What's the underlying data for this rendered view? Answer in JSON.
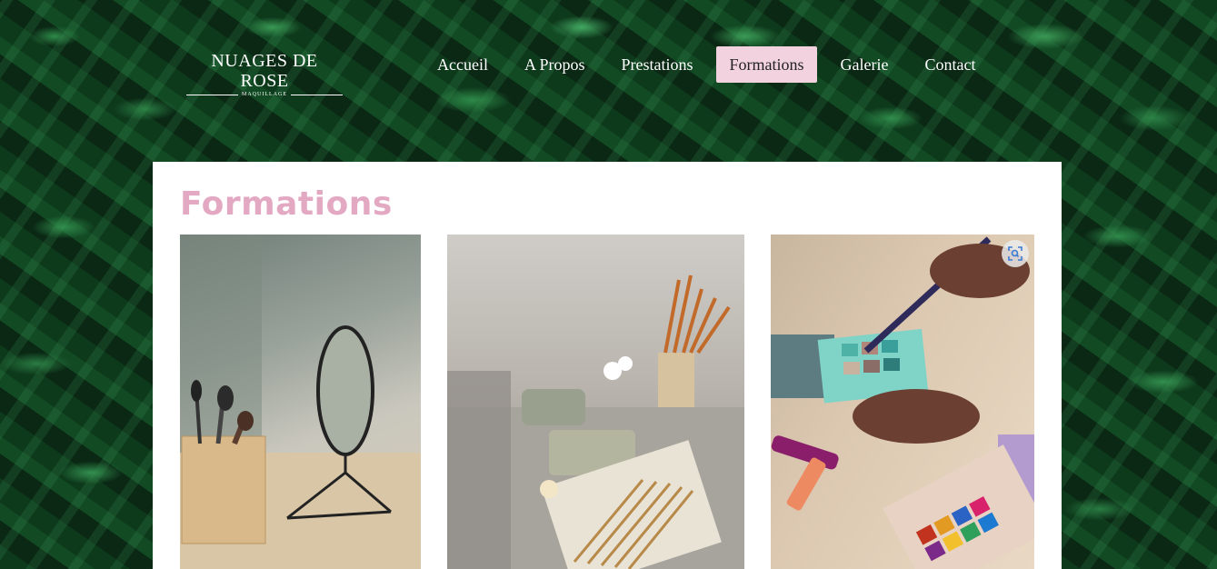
{
  "logo": {
    "main": "NUAGES DE ROSE",
    "sub": "MAQUILLAGE"
  },
  "nav": {
    "items": [
      "Accueil",
      "A Propos",
      "Prestations",
      "Formations",
      "Galerie",
      "Contact"
    ],
    "active": "Formations"
  },
  "page": {
    "title": "Formations"
  },
  "gallery": {
    "images": [
      {
        "subject": "makeup brushes in wooden holder with round mirror"
      },
      {
        "subject": "paint brushes, palette and candle on table"
      },
      {
        "subject": "hand applying eyeshadow from teal palette"
      }
    ],
    "zoom_icon": "visual-search-icon"
  },
  "colors": {
    "accent_pink": "#e3a9c3",
    "nav_active_bg": "#f2d2df"
  }
}
